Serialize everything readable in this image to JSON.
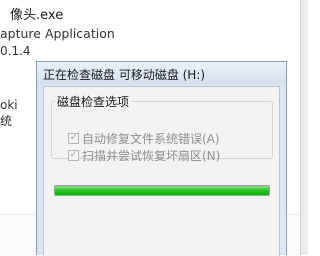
{
  "background": {
    "file_name": "像头.exe",
    "app_description": "apture Application",
    "version": "0.1.4",
    "word1": "oki",
    "word2": "统"
  },
  "dialog": {
    "title": "正在检查磁盘 可移动磁盘 (H:)",
    "group_label": "磁盘检查选项",
    "options": [
      {
        "label": "自动修复文件系统错误(A)",
        "checked": true
      },
      {
        "label": "扫描并尝试恢复坏扇区(N)",
        "checked": true
      }
    ],
    "progress_fraction": 1.0,
    "accent_color": "#22c122"
  }
}
